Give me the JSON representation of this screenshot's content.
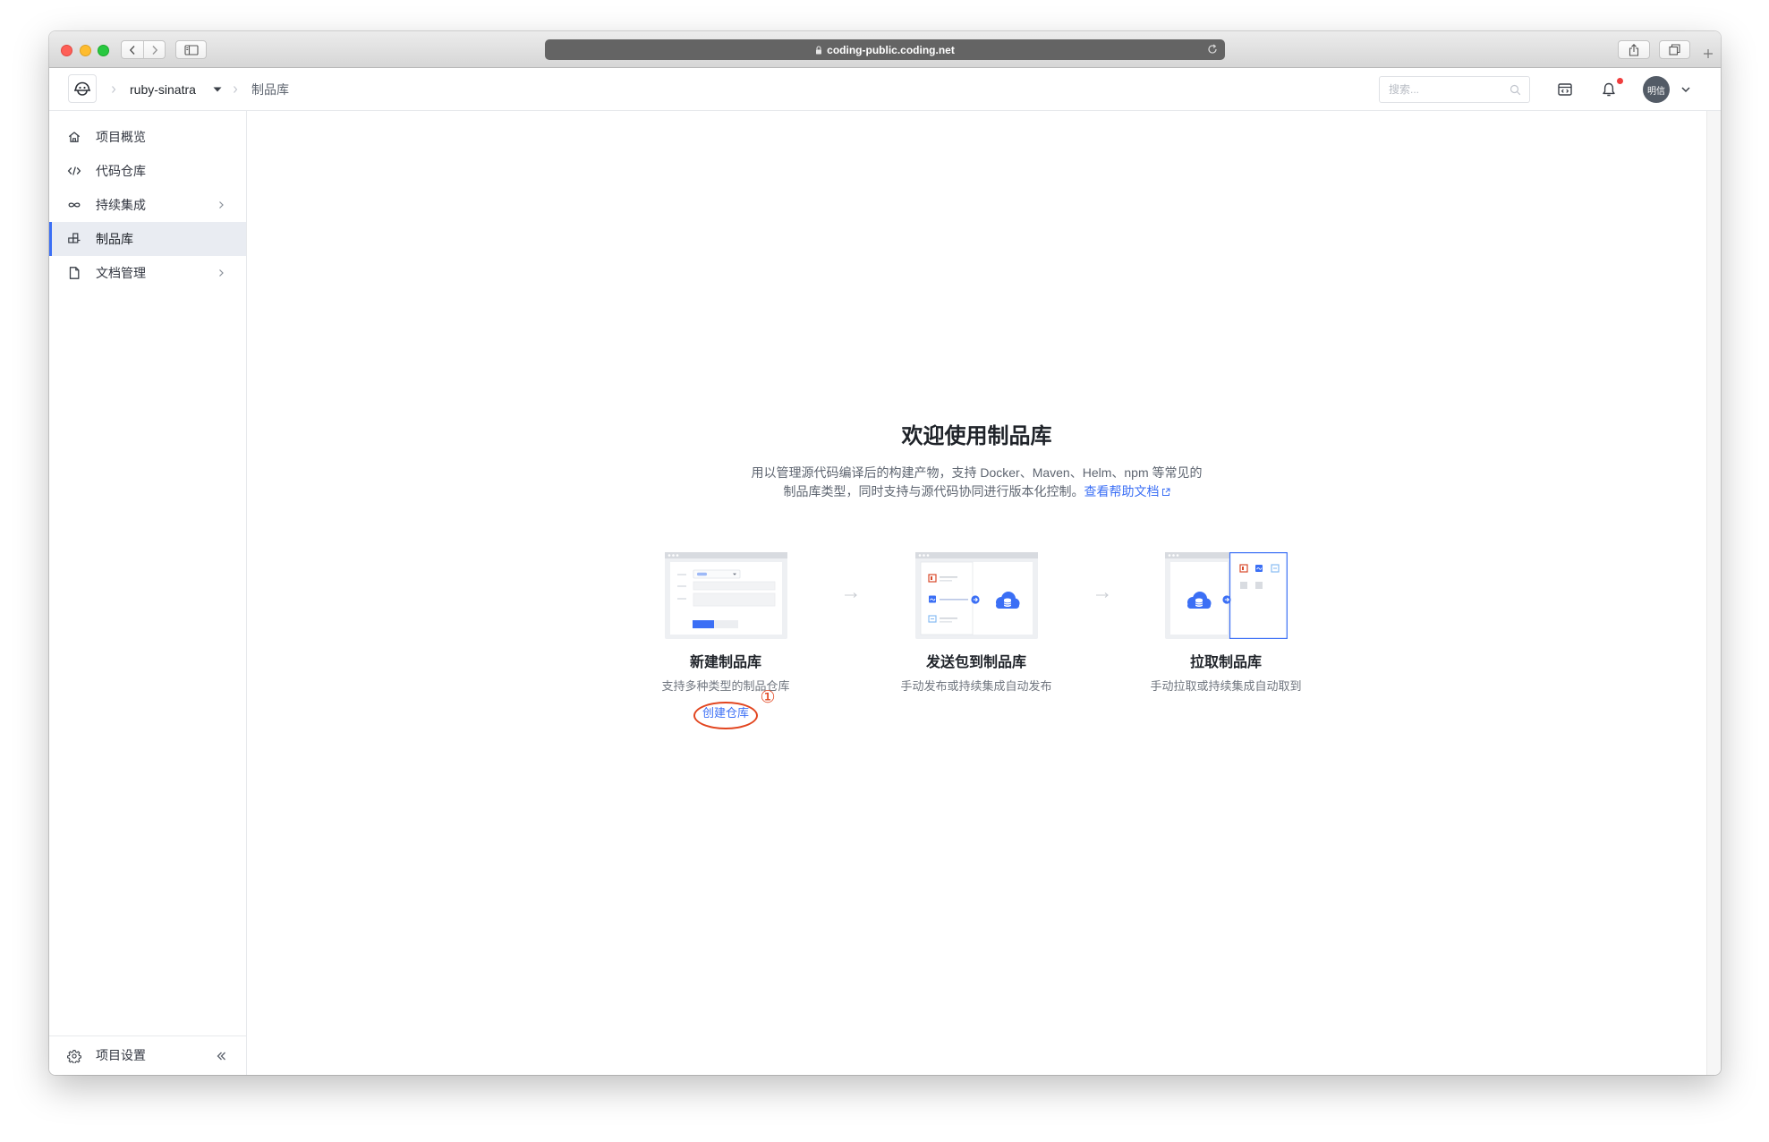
{
  "browser": {
    "url": "coding-public.coding.net"
  },
  "header": {
    "project": "ruby-sinatra",
    "current": "制品库",
    "search_placeholder": "搜索...",
    "avatar": "明信",
    "has_notification": true
  },
  "sidebar": {
    "items": [
      {
        "label": "项目概览",
        "icon": "home-icon",
        "active": false,
        "expandable": false
      },
      {
        "label": "代码仓库",
        "icon": "code-icon",
        "active": false,
        "expandable": false
      },
      {
        "label": "持续集成",
        "icon": "infinity-icon",
        "active": false,
        "expandable": true
      },
      {
        "label": "制品库",
        "icon": "artifact-icon",
        "active": true,
        "expandable": false
      },
      {
        "label": "文档管理",
        "icon": "document-icon",
        "active": false,
        "expandable": true
      }
    ],
    "settings_label": "项目设置"
  },
  "main": {
    "title": "欢迎使用制品库",
    "desc_line1": "用以管理源代码编译后的构建产物，支持 Docker、Maven、Helm、npm 等常见的",
    "desc_line2": "制品库类型，同时支持与源代码协同进行版本化控制。",
    "help_link": "查看帮助文档",
    "steps": [
      {
        "title": "新建制品库",
        "subtitle": "支持多种类型的制品仓库"
      },
      {
        "title": "发送包到制品库",
        "subtitle": "手动发布或持续集成自动发布"
      },
      {
        "title": "拉取制品库",
        "subtitle": "手动拉取或持续集成自动取到"
      }
    ],
    "create_link": "创建仓库"
  },
  "annotation": {
    "marker": "①"
  },
  "colors": {
    "accent": "#3b6ff5",
    "annotation": "#e2451f",
    "notification_dot": "#f03e3e"
  }
}
